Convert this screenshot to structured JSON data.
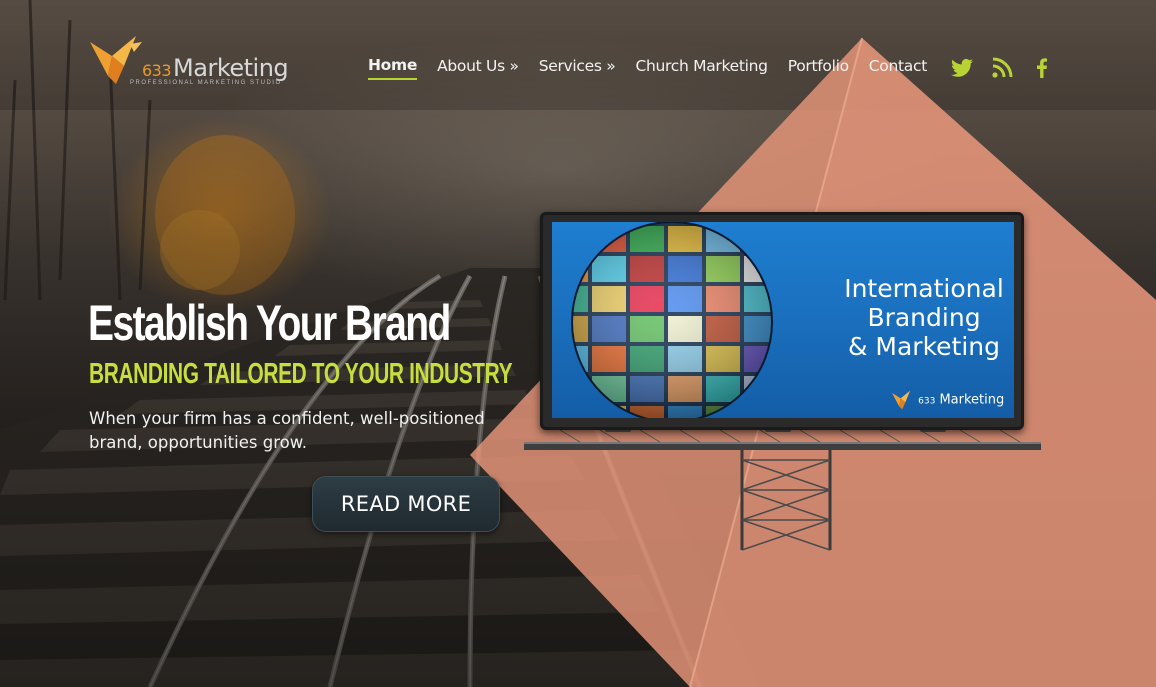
{
  "logo": {
    "number": "633",
    "name": "Marketing",
    "tagline": "PROFESSIONAL MARKETING STUDIO"
  },
  "nav": {
    "items": [
      {
        "label": "Home",
        "active": true
      },
      {
        "label": "About Us »"
      },
      {
        "label": "Services »"
      },
      {
        "label": "Church Marketing"
      },
      {
        "label": "Portfolio"
      },
      {
        "label": "Contact"
      }
    ]
  },
  "social": {
    "icons": [
      "twitter-icon",
      "rss-icon",
      "facebook-icon"
    ],
    "color": "#b7d334"
  },
  "hero": {
    "title": "Establish Your Brand",
    "subtitle": "BRANDING TAILORED TO YOUR INDUSTRY",
    "body": "When your firm has a confident, well-positioned brand, opportunities grow.",
    "cta_label": "READ MORE"
  },
  "billboard": {
    "line1": "International",
    "line2": "Branding",
    "line3": "& Marketing",
    "logo_number": "633",
    "logo_name": "Marketing"
  },
  "colors": {
    "accent_green": "#c6df3f",
    "pyramid": "#e8967a",
    "logo_orange": "#e89a2c"
  }
}
